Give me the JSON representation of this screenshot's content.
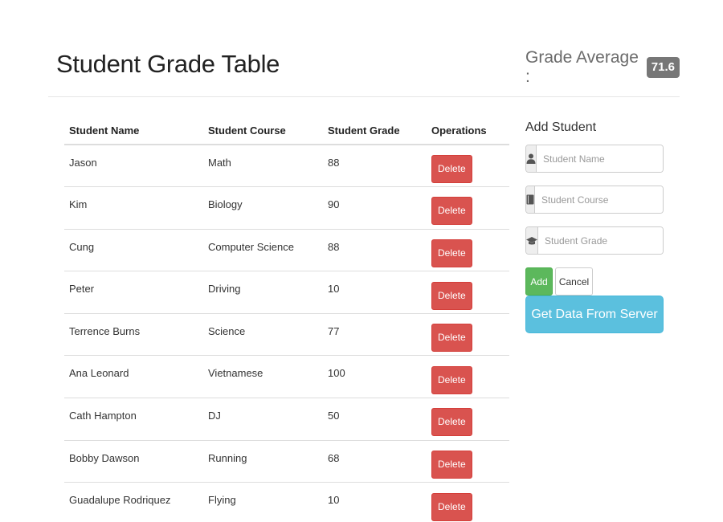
{
  "header": {
    "title": "Student Grade Table",
    "grade_average_label": "Grade Average :",
    "grade_average_value": "71.6"
  },
  "table": {
    "columns": [
      "Student Name",
      "Student Course",
      "Student Grade",
      "Operations"
    ],
    "delete_label": "Delete",
    "rows": [
      {
        "name": "Jason",
        "course": "Math",
        "grade": "88"
      },
      {
        "name": "Kim",
        "course": "Biology",
        "grade": "90"
      },
      {
        "name": "Cung",
        "course": "Computer Science",
        "grade": "88"
      },
      {
        "name": "Peter",
        "course": "Driving",
        "grade": "10"
      },
      {
        "name": "Terrence Burns",
        "course": "Science",
        "grade": "77"
      },
      {
        "name": "Ana Leonard",
        "course": "Vietnamese",
        "grade": "100"
      },
      {
        "name": "Cath Hampton",
        "course": "DJ",
        "grade": "50"
      },
      {
        "name": "Bobby Dawson",
        "course": "Running",
        "grade": "68"
      },
      {
        "name": "Guadalupe Rodriquez",
        "course": "Flying",
        "grade": "10"
      }
    ]
  },
  "form": {
    "title": "Add Student",
    "name_placeholder": "Student Name",
    "course_placeholder": "Student Course",
    "grade_placeholder": "Student Grade",
    "name_icon": "user-icon",
    "course_icon": "book-icon",
    "grade_icon": "graduation-cap-icon",
    "add_label": "Add",
    "cancel_label": "Cancel",
    "server_label": "Get Data From Server"
  },
  "colors": {
    "danger": "#d9534f",
    "success": "#5cb85c",
    "info": "#5bc0de",
    "badge": "#777777"
  }
}
